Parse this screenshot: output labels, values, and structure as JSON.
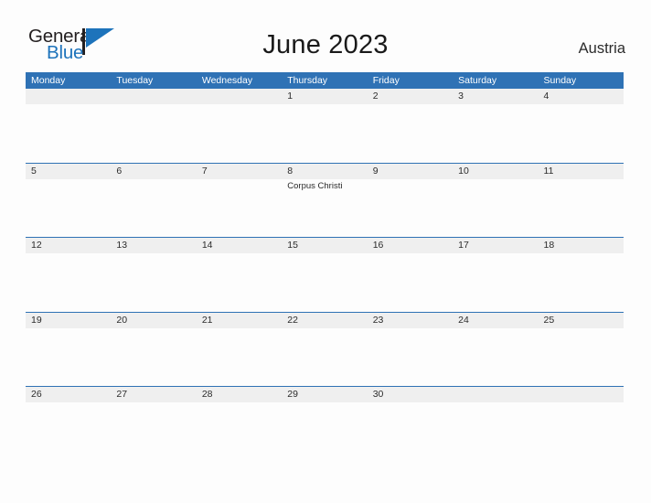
{
  "brand": {
    "name_part1": "General",
    "name_part2": "Blue",
    "flag_icon": "blue-flag-triangle",
    "accent_color": "#1d73bb"
  },
  "header": {
    "title": "June 2023",
    "country": "Austria"
  },
  "calendar": {
    "month": "June",
    "year": "2023",
    "header_color": "#2f72b5",
    "band_color": "#efefef",
    "weekdays": [
      "Monday",
      "Tuesday",
      "Wednesday",
      "Thursday",
      "Friday",
      "Saturday",
      "Sunday"
    ],
    "weeks": [
      [
        {
          "date": "",
          "events": []
        },
        {
          "date": "",
          "events": []
        },
        {
          "date": "",
          "events": []
        },
        {
          "date": "1",
          "events": []
        },
        {
          "date": "2",
          "events": []
        },
        {
          "date": "3",
          "events": []
        },
        {
          "date": "4",
          "events": []
        }
      ],
      [
        {
          "date": "5",
          "events": []
        },
        {
          "date": "6",
          "events": []
        },
        {
          "date": "7",
          "events": []
        },
        {
          "date": "8",
          "events": [
            "Corpus Christi"
          ]
        },
        {
          "date": "9",
          "events": []
        },
        {
          "date": "10",
          "events": []
        },
        {
          "date": "11",
          "events": []
        }
      ],
      [
        {
          "date": "12",
          "events": []
        },
        {
          "date": "13",
          "events": []
        },
        {
          "date": "14",
          "events": []
        },
        {
          "date": "15",
          "events": []
        },
        {
          "date": "16",
          "events": []
        },
        {
          "date": "17",
          "events": []
        },
        {
          "date": "18",
          "events": []
        }
      ],
      [
        {
          "date": "19",
          "events": []
        },
        {
          "date": "20",
          "events": []
        },
        {
          "date": "21",
          "events": []
        },
        {
          "date": "22",
          "events": []
        },
        {
          "date": "23",
          "events": []
        },
        {
          "date": "24",
          "events": []
        },
        {
          "date": "25",
          "events": []
        }
      ],
      [
        {
          "date": "26",
          "events": []
        },
        {
          "date": "27",
          "events": []
        },
        {
          "date": "28",
          "events": []
        },
        {
          "date": "29",
          "events": []
        },
        {
          "date": "30",
          "events": []
        },
        {
          "date": "",
          "events": []
        },
        {
          "date": "",
          "events": []
        }
      ]
    ]
  }
}
